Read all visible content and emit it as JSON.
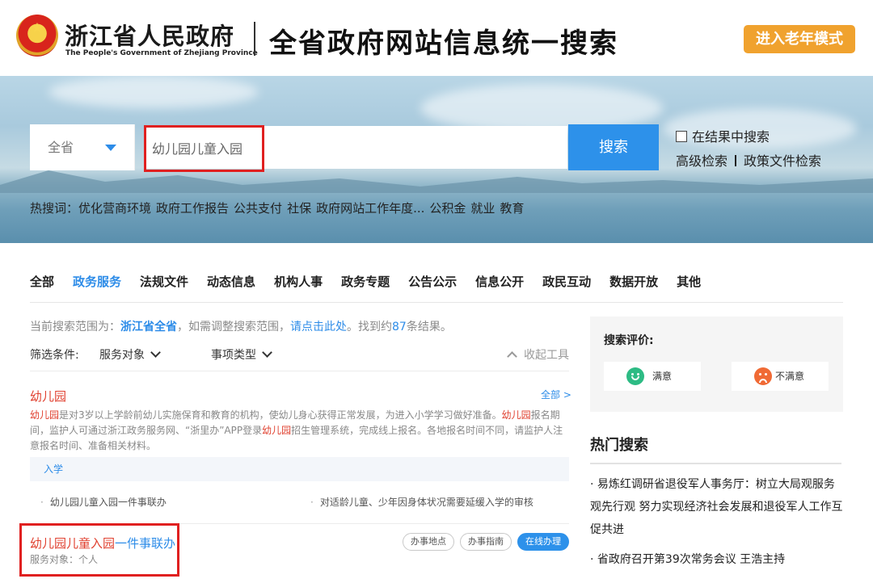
{
  "header": {
    "brand_cn": "浙江省人民政府",
    "brand_en": "The People's Government of Zhejiang Province",
    "title": "全省政府网站信息统一搜索",
    "elder_mode": "进入老年模式"
  },
  "search": {
    "scope": "全省",
    "query": "幼儿园儿童入园",
    "button": "搜索",
    "in_results": "在结果中搜索",
    "advanced": "高级检索",
    "policy": "政策文件检索",
    "hot_label": "热搜词：",
    "hot_words": [
      "优化营商环境",
      "政府工作报告",
      "公共支付",
      "社保",
      "政府网站工作年度...",
      "公积金",
      "就业",
      "教育"
    ]
  },
  "tabs": [
    "全部",
    "政务服务",
    "法规文件",
    "动态信息",
    "机构人事",
    "政务专题",
    "公告公示",
    "信息公开",
    "政民互动",
    "数据开放",
    "其他"
  ],
  "scope_info": {
    "prefix": "当前搜索范围为：",
    "scope": "浙江省全省",
    "mid": "，如需调整搜索范围，",
    "link": "请点击此处",
    "found_pre": "。找到约",
    "count": "87",
    "found_post": "条结果。"
  },
  "filters": {
    "label": "筛选条件:",
    "audience": "服务对象",
    "type": "事项类型",
    "collapse": "收起工具"
  },
  "card": {
    "title": "幼儿园",
    "all": "全部 >",
    "desc_hl1": "幼儿园",
    "desc_part1": "是对3岁以上学龄前幼儿实施保育和教育的机构，使幼儿身心获得正常发展，为进入小学学习做好准备。",
    "desc_hl2": "幼儿园",
    "desc_part2": "报名期间，监护人可通过浙江政务服务网、“浙里办”APP登录",
    "desc_hl3": "幼儿园",
    "desc_part3": "招生管理系统，完成线上报名。各地报名时间不同，请监护人注意报名时间、准备相关材料。",
    "subbar": "入学",
    "sub_items": [
      "幼儿园儿童入园一件事联办",
      "对适龄儿童、少年因身体状况需要延缓入学的审核"
    ]
  },
  "result": {
    "title_hl": "幼儿园儿童入园",
    "title_rest": "一件事联办",
    "meta": "服务对象：个人",
    "btn_place": "办事地点",
    "btn_guide": "办事指南",
    "btn_online": "在线办理"
  },
  "evaluation": {
    "title": "搜索评价:",
    "satisfied": "满意",
    "unsatisfied": "不满意"
  },
  "hot": {
    "title": "热门搜索",
    "items": [
      "易炼红调研省退役军人事务厅：树立大局观服务观先行观 努力实现经济社会发展和退役军人工作互促共进",
      "省政府召开第39次常务会议 王浩主持"
    ]
  },
  "colors": {
    "accent_blue": "#2d8ce8",
    "highlight_red": "#e0402f",
    "elder_orange": "#f0a22e"
  }
}
